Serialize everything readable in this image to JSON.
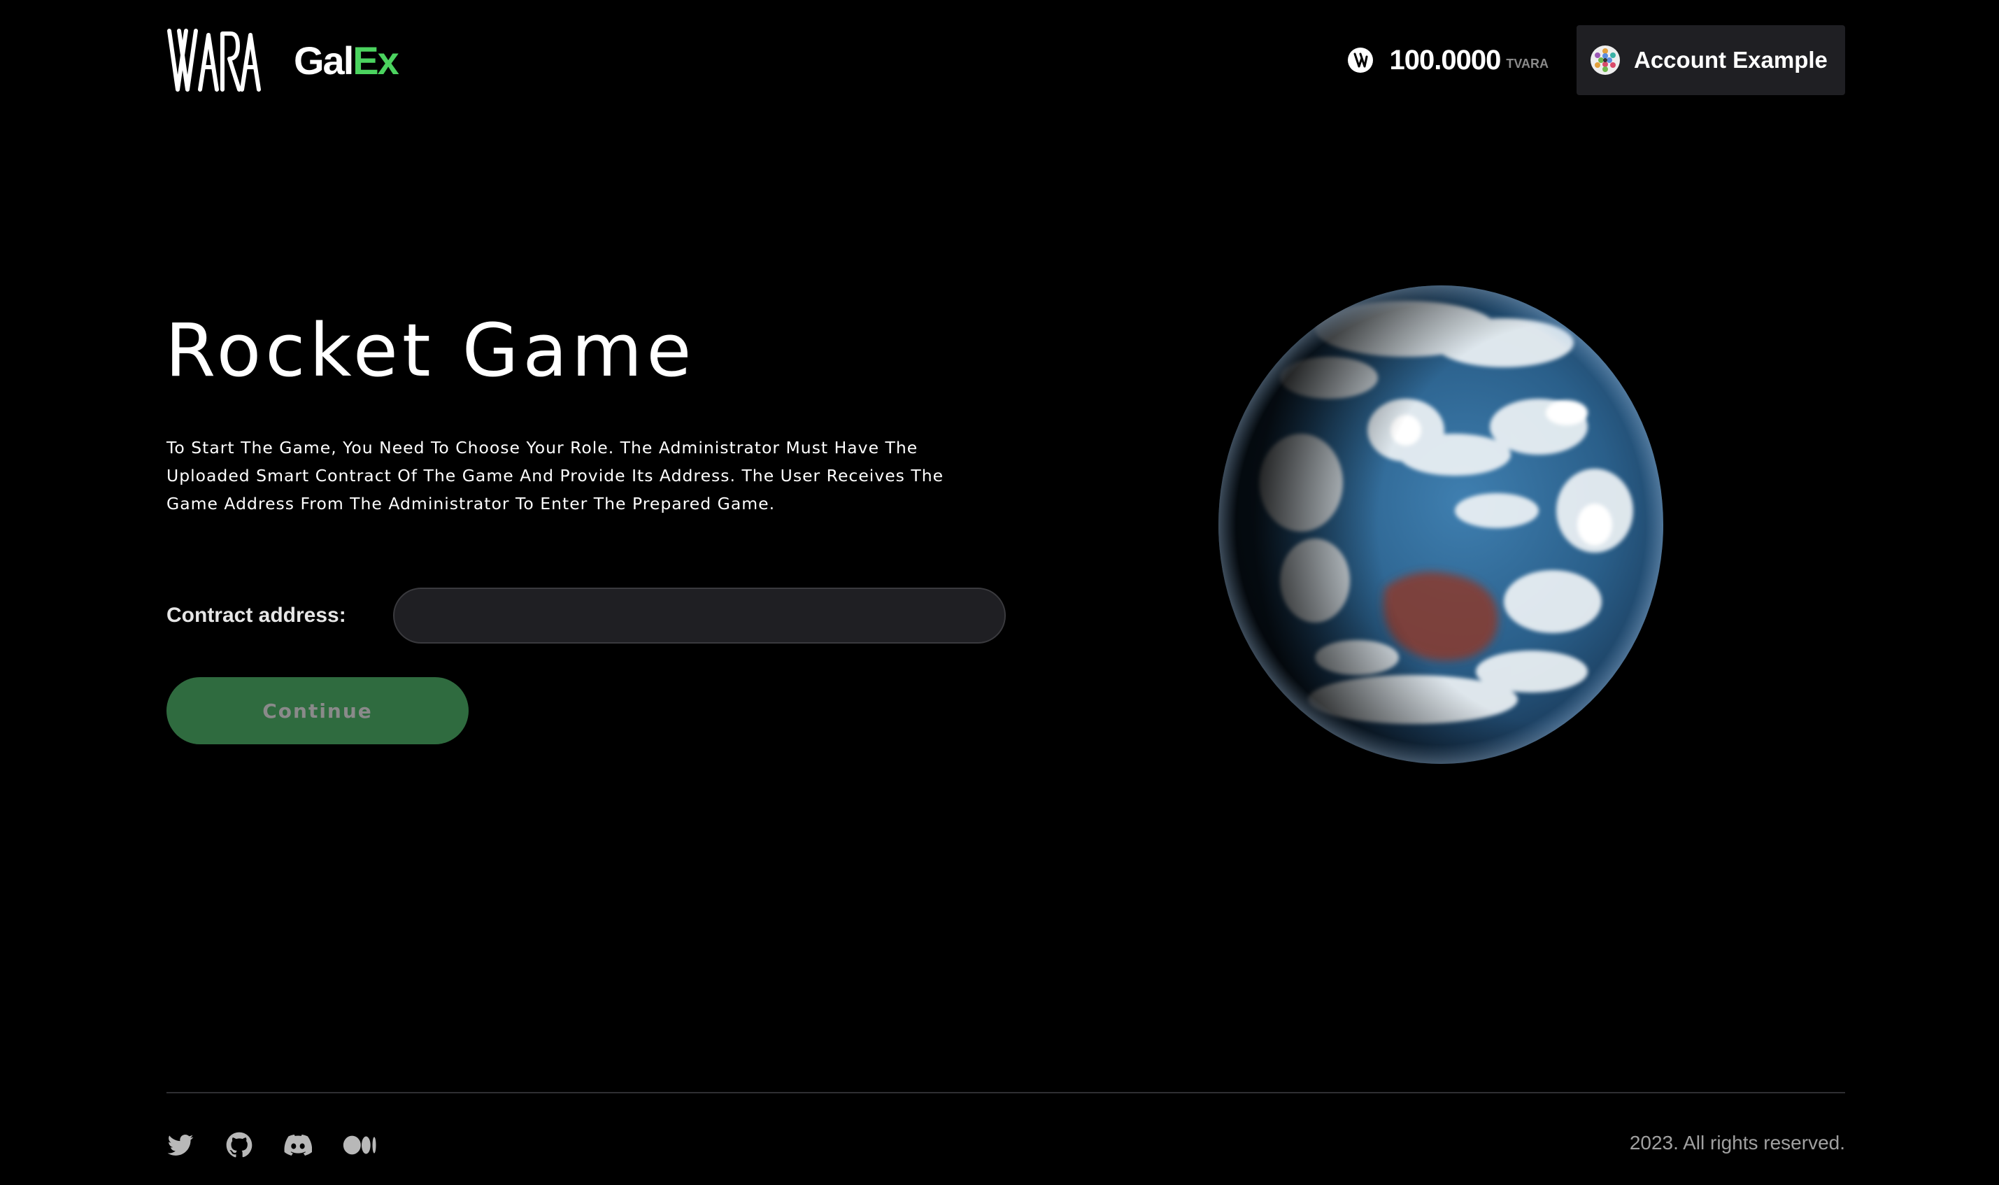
{
  "header": {
    "logo": "VARA",
    "app_name_part1": "Gal",
    "app_name_part2": "Ex",
    "balance": {
      "value": "100.0000",
      "unit": "TVARA",
      "icon": "vara-coin-icon"
    },
    "account": {
      "label": "Account Example",
      "icon": "identicon-avatar"
    }
  },
  "main": {
    "title": "Rocket Game",
    "description": "To Start The Game, You Need To Choose Your Role. The Administrator Must Have The Uploaded Smart Contract Of The Game And Provide Its Address. The User Receives The Game Address From The Administrator To Enter The Prepared Game.",
    "form": {
      "label": "Contract address:",
      "value": "",
      "placeholder": ""
    },
    "continue_label": "Continue",
    "image": "earth-globe"
  },
  "footer": {
    "socials": [
      "twitter-icon",
      "github-icon",
      "discord-icon",
      "medium-icon"
    ],
    "copyright": "2023. All rights reserved."
  },
  "colors": {
    "background": "#000000",
    "accent": "#4bd35f",
    "button": "#2f6b3f",
    "input": "#1f1f23"
  }
}
